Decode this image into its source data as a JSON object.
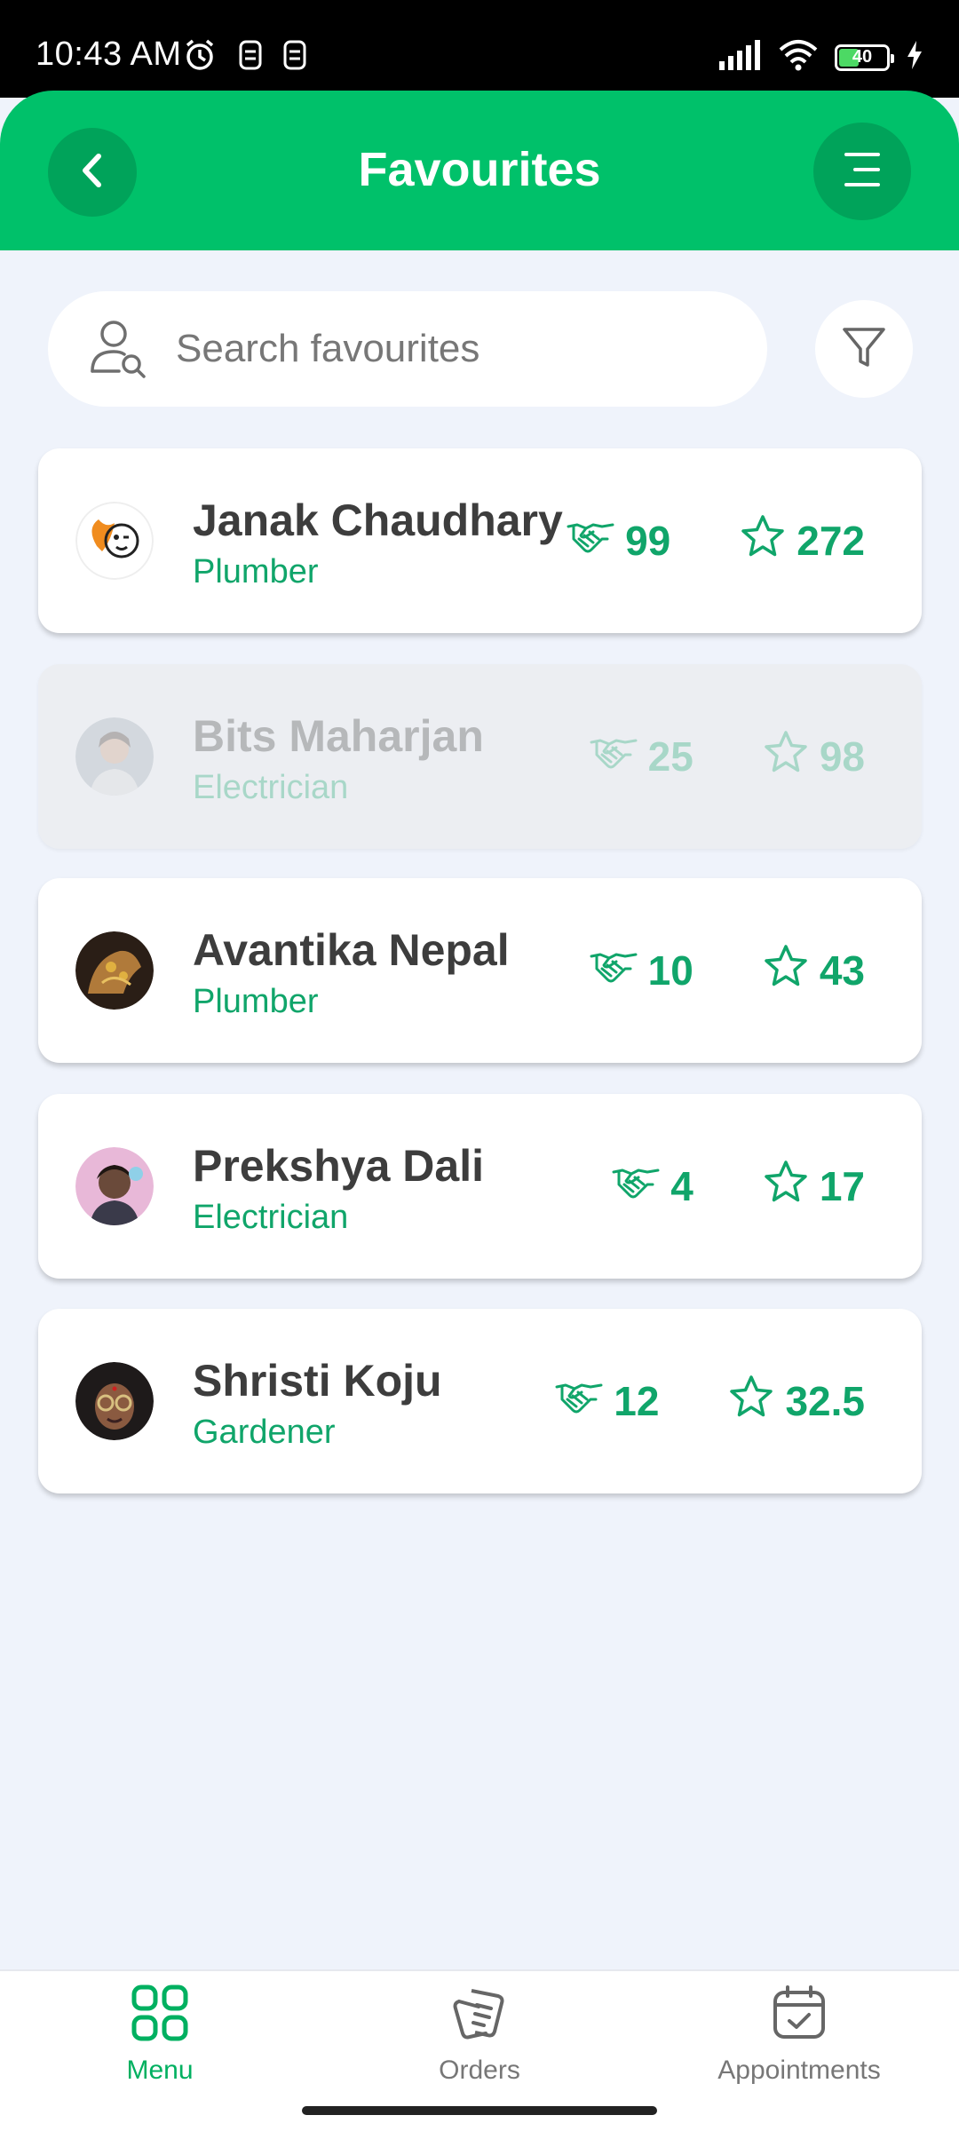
{
  "status_bar": {
    "time": "10:43 AM",
    "battery": "40",
    "icons": [
      "alarm-icon",
      "sim-icon",
      "sim-icon",
      "signal-icon",
      "wifi-icon",
      "battery-icon",
      "charging-icon"
    ]
  },
  "header": {
    "title": "Favourites",
    "back_icon": "chevron-left-icon",
    "menu_icon": "menu-icon"
  },
  "search": {
    "placeholder": "Search favourites",
    "value": "",
    "filter_icon": "filter-icon"
  },
  "favourites": [
    {
      "name": "Janak Chaudhary",
      "role": "Plumber",
      "deals": "99",
      "rating": "272",
      "disabled": false
    },
    {
      "name": "Bits Maharjan",
      "role": "Electrician",
      "deals": "25",
      "rating": "98",
      "disabled": true
    },
    {
      "name": "Avantika Nepal",
      "role": "Plumber",
      "deals": "10",
      "rating": "43",
      "disabled": false
    },
    {
      "name": "Prekshya Dali",
      "role": "Electrician",
      "deals": "4",
      "rating": "17",
      "disabled": false
    },
    {
      "name": "Shristi Koju",
      "role": "Gardener",
      "deals": "12",
      "rating": "32.5",
      "disabled": false
    }
  ],
  "bottom_nav": {
    "items": [
      {
        "label": "Menu",
        "icon": "grid-icon",
        "active": true
      },
      {
        "label": "Orders",
        "icon": "orders-icon",
        "active": false
      },
      {
        "label": "Appointments",
        "icon": "calendar-check-icon",
        "active": false
      }
    ]
  },
  "colors": {
    "brand_green": "#00c16a",
    "accent_text": "#10a56a",
    "background": "#eff3fb"
  }
}
